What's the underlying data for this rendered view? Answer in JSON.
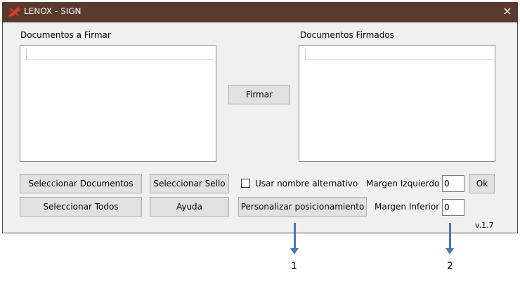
{
  "window": {
    "title": "LENOX - SIGN",
    "close_label": "×"
  },
  "lists": {
    "pending_label": "Documentos a Firmar",
    "signed_label": "Documentos Firmados"
  },
  "buttons": {
    "sign": "Firmar",
    "select_documents": "Seleccionar Documentos",
    "select_seal": "Seleccionar Sello",
    "select_all": "Seleccionar Todos",
    "help": "Ayuda",
    "customize_position": "Personalizar posicionamiento",
    "ok": "Ok"
  },
  "options": {
    "alt_name_label": "Usar nombre alternativo",
    "alt_name_checked": false,
    "left_margin_label": "Margen Izquierdo",
    "left_margin_value": "0",
    "bottom_margin_label": "Margen Inferior",
    "bottom_margin_value": "0"
  },
  "version": "v.1.7",
  "annotations": {
    "marker_1": "1",
    "marker_2": "2",
    "arrow_color": "#4a74c4"
  },
  "colors": {
    "titlebar": "#5a3a2e",
    "logo": "#e23a2a"
  }
}
